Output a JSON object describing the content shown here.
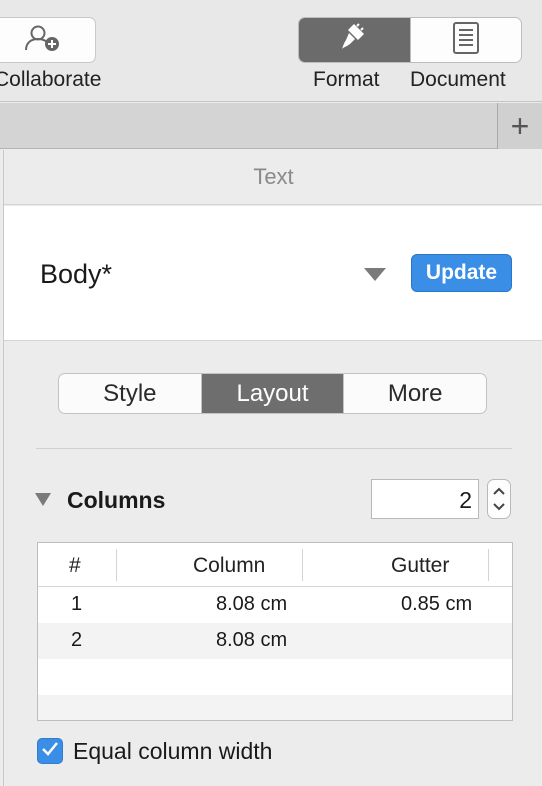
{
  "toolbar": {
    "collaborate_label": "Collaborate",
    "format_label": "Format",
    "document_label": "Document"
  },
  "tabstrip": {
    "add_label": "+"
  },
  "inspector": {
    "header": "Text",
    "paragraph_style": {
      "name": "Body*",
      "update_label": "Update"
    },
    "tabs": [
      {
        "label": "Style",
        "active": false
      },
      {
        "label": "Layout",
        "active": true
      },
      {
        "label": "More",
        "active": false
      }
    ],
    "columns": {
      "title": "Columns",
      "count": "2",
      "table": {
        "headers": [
          "#",
          "Column",
          "Gutter"
        ],
        "rows": [
          {
            "index": "1",
            "column": "8.08 cm",
            "gutter": "0.85 cm"
          },
          {
            "index": "2",
            "column": "8.08 cm",
            "gutter": ""
          }
        ]
      },
      "equal_width": {
        "label": "Equal column width",
        "checked": true
      }
    }
  },
  "colors": {
    "accent": "#3a8ee6",
    "active_segment": "#6e6e6e"
  }
}
